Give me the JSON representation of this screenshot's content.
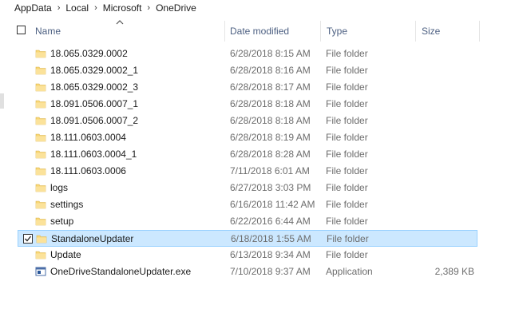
{
  "breadcrumb": [
    "AppData",
    "Local",
    "Microsoft",
    "OneDrive"
  ],
  "columns": {
    "name": "Name",
    "date": "Date modified",
    "type": "Type",
    "size": "Size"
  },
  "rows": [
    {
      "name": "18.065.0329.0002",
      "date": "6/28/2018 8:15 AM",
      "type": "File folder",
      "size": "",
      "icon": "folder-icon",
      "selected": false
    },
    {
      "name": "18.065.0329.0002_1",
      "date": "6/28/2018 8:16 AM",
      "type": "File folder",
      "size": "",
      "icon": "folder-icon",
      "selected": false
    },
    {
      "name": "18.065.0329.0002_3",
      "date": "6/28/2018 8:17 AM",
      "type": "File folder",
      "size": "",
      "icon": "folder-icon",
      "selected": false
    },
    {
      "name": "18.091.0506.0007_1",
      "date": "6/28/2018 8:18 AM",
      "type": "File folder",
      "size": "",
      "icon": "folder-icon",
      "selected": false
    },
    {
      "name": "18.091.0506.0007_2",
      "date": "6/28/2018 8:18 AM",
      "type": "File folder",
      "size": "",
      "icon": "folder-icon",
      "selected": false
    },
    {
      "name": "18.111.0603.0004",
      "date": "6/28/2018 8:19 AM",
      "type": "File folder",
      "size": "",
      "icon": "folder-icon",
      "selected": false
    },
    {
      "name": "18.111.0603.0004_1",
      "date": "6/28/2018 8:28 AM",
      "type": "File folder",
      "size": "",
      "icon": "folder-icon",
      "selected": false
    },
    {
      "name": "18.111.0603.0006",
      "date": "7/11/2018 6:01 AM",
      "type": "File folder",
      "size": "",
      "icon": "folder-icon",
      "selected": false
    },
    {
      "name": "logs",
      "date": "6/27/2018 3:03 PM",
      "type": "File folder",
      "size": "",
      "icon": "folder-icon",
      "selected": false
    },
    {
      "name": "settings",
      "date": "6/16/2018 11:42 AM",
      "type": "File folder",
      "size": "",
      "icon": "folder-icon",
      "selected": false
    },
    {
      "name": "setup",
      "date": "6/22/2016 6:44 AM",
      "type": "File folder",
      "size": "",
      "icon": "folder-icon",
      "selected": false
    },
    {
      "name": "StandaloneUpdater",
      "date": "6/18/2018 1:55 AM",
      "type": "File folder",
      "size": "",
      "icon": "folder-icon",
      "selected": true
    },
    {
      "name": "Update",
      "date": "6/13/2018 9:34 AM",
      "type": "File folder",
      "size": "",
      "icon": "folder-icon",
      "selected": false
    },
    {
      "name": "OneDriveStandaloneUpdater.exe",
      "date": "7/10/2018 9:37 AM",
      "type": "Application",
      "size": "2,389 KB",
      "icon": "application-icon",
      "selected": false
    }
  ],
  "colors": {
    "selected_bg": "#cce8ff",
    "selected_border": "#99d1ff",
    "header_text": "#4d6082",
    "folder_yellow": "#f8d775"
  }
}
